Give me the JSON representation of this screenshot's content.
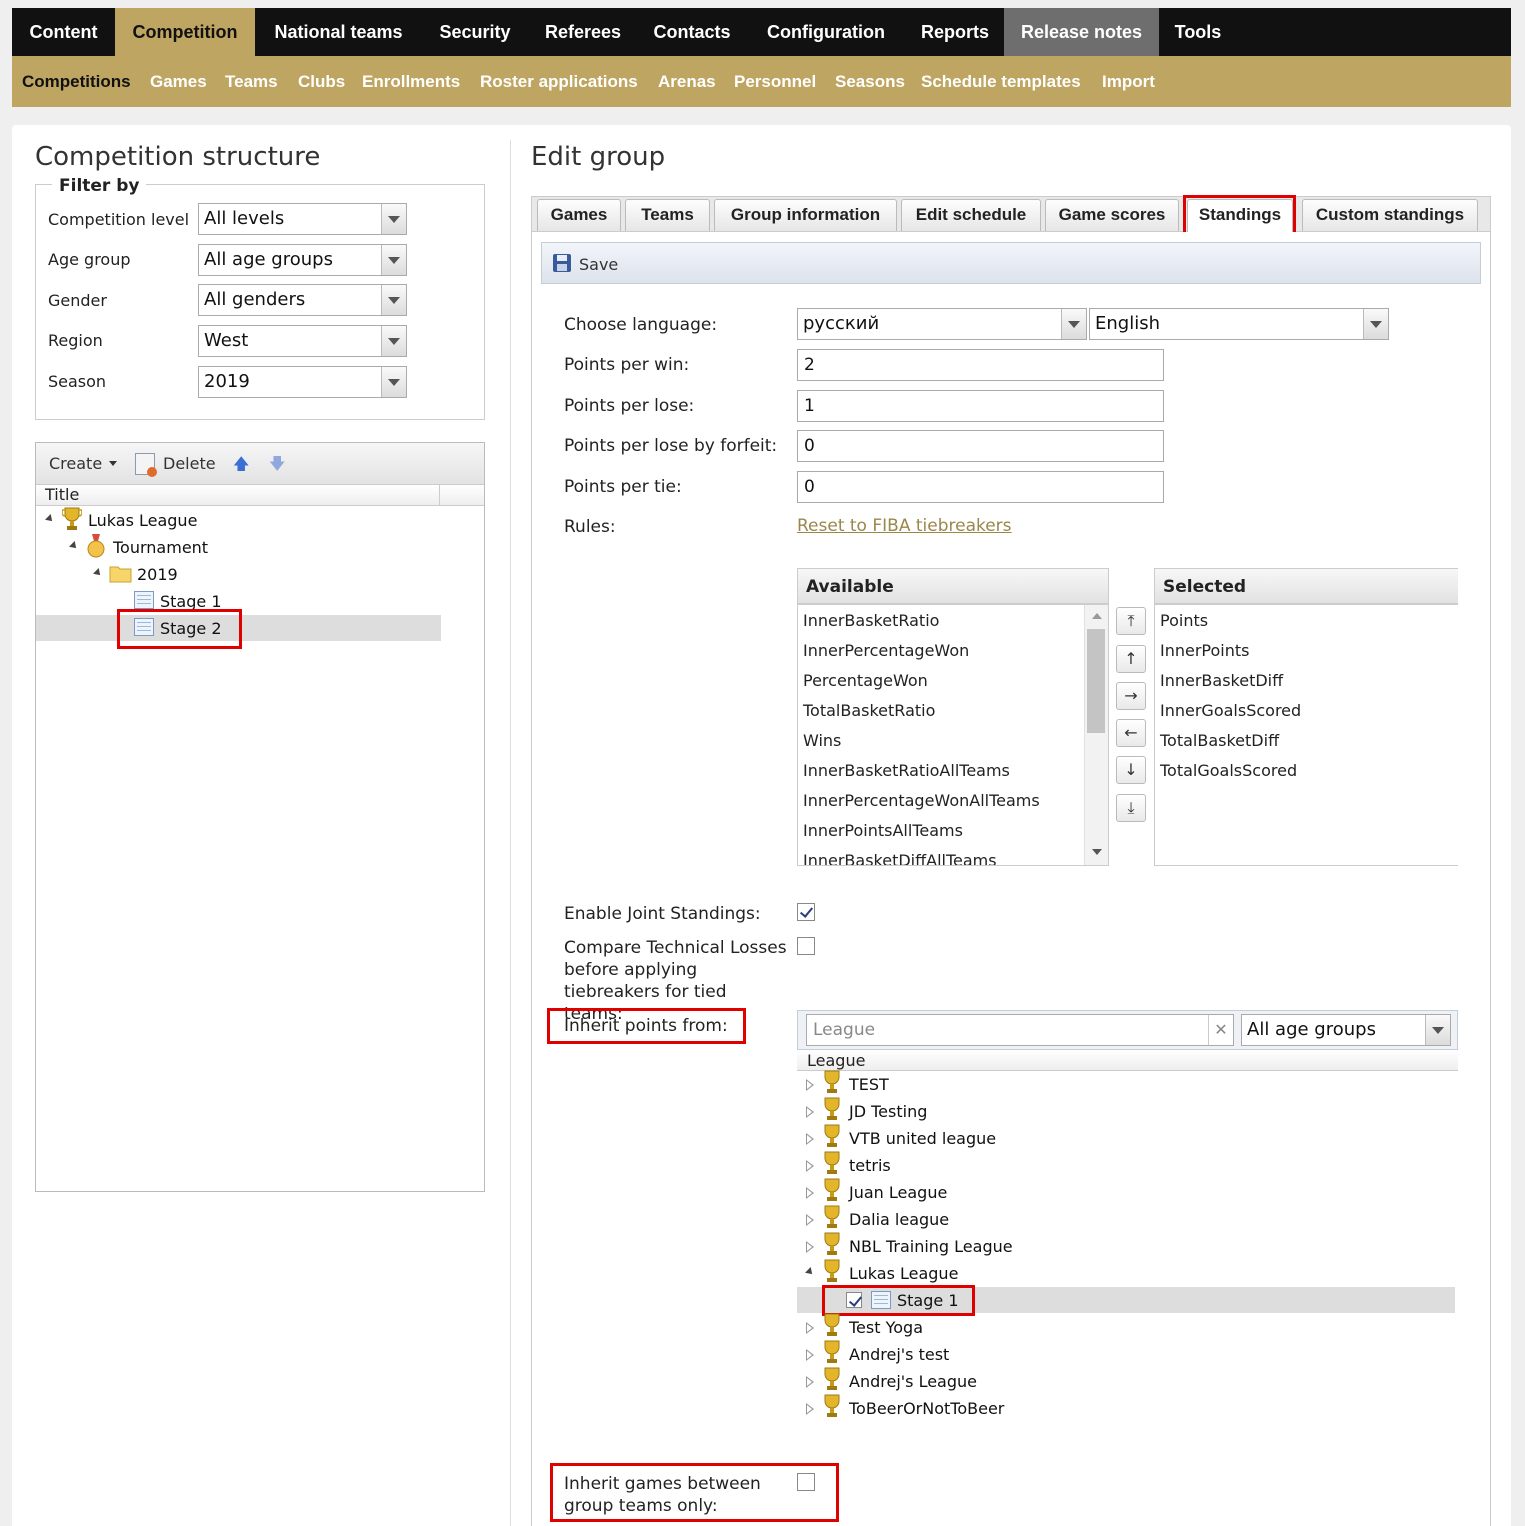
{
  "topnav": {
    "items": [
      "Content",
      "Competition",
      "National teams",
      "Security",
      "Referees",
      "Contacts",
      "Configuration",
      "Reports",
      "Release notes",
      "Tools"
    ],
    "active": "Competition"
  },
  "subnav": {
    "items": [
      "Competitions",
      "Games",
      "Teams",
      "Clubs",
      "Enrollments",
      "Roster applications",
      "Arenas",
      "Personnel",
      "Seasons",
      "Schedule templates",
      "Import"
    ],
    "active": "Competitions"
  },
  "left": {
    "title": "Competition structure",
    "filter_legend": "Filter by",
    "filters": [
      {
        "label": "Competition level",
        "value": "All levels"
      },
      {
        "label": "Age group",
        "value": "All age groups"
      },
      {
        "label": "Gender",
        "value": "All genders"
      },
      {
        "label": "Region",
        "value": "West"
      },
      {
        "label": "Season",
        "value": "2019"
      }
    ],
    "toolbar": {
      "create": "Create",
      "delete": "Delete"
    },
    "tree_header": "Title",
    "tree": {
      "league": "Lukas League",
      "tournament": "Tournament",
      "season": "2019",
      "stage1": "Stage 1",
      "stage2": "Stage 2"
    }
  },
  "right": {
    "title": "Edit group",
    "tabs": [
      "Games",
      "Teams",
      "Group information",
      "Edit schedule",
      "Game scores",
      "Standings",
      "Custom standings"
    ],
    "active_tab": "Standings",
    "save": "Save",
    "fields": {
      "language_label": "Choose language:",
      "language_1": "русский",
      "language_2": "English",
      "win_label": "Points per win:",
      "win": "2",
      "lose_label": "Points per lose:",
      "lose": "1",
      "forfeit_label": "Points per lose by forfeit:",
      "forfeit": "0",
      "tie_label": "Points per tie:",
      "tie": "0",
      "rules_label": "Rules:",
      "reset_link": "Reset to FIBA tiebreakers"
    },
    "available_header": "Available",
    "available": [
      "InnerBasketRatio",
      "InnerPercentageWon",
      "PercentageWon",
      "TotalBasketRatio",
      "Wins",
      "InnerBasketRatioAllTeams",
      "InnerPercentageWonAllTeams",
      "InnerPointsAllTeams",
      "InnerBasketDiffAllTeams"
    ],
    "selected_header": "Selected",
    "selected": [
      "Points",
      "InnerPoints",
      "InnerBasketDiff",
      "InnerGoalsScored",
      "TotalBasketDiff",
      "TotalGoalsScored"
    ],
    "joint_label": "Enable Joint Standings:",
    "joint_checked": true,
    "tech_label": "Compare Technical Losses before applying tiebreakers for tied teams:",
    "tech_checked": false,
    "inherit_label": "Inherit points from:",
    "inherit_search_placeholder": "League",
    "inherit_age": "All age groups",
    "inherit_header": "League",
    "leagues": [
      "TEST",
      "JD Testing",
      "VTB united league",
      "tetris",
      "Juan League",
      "Dalia league",
      "NBL Training League",
      "Lukas League"
    ],
    "lukas_child": "Stage 1",
    "leagues_after": [
      "Test Yoga",
      "Andrej's test",
      "Andrej's League",
      "ToBeerOrNotToBeer"
    ],
    "inherit_games_label": "Inherit games between group teams only:",
    "inherit_games_checked": false
  }
}
